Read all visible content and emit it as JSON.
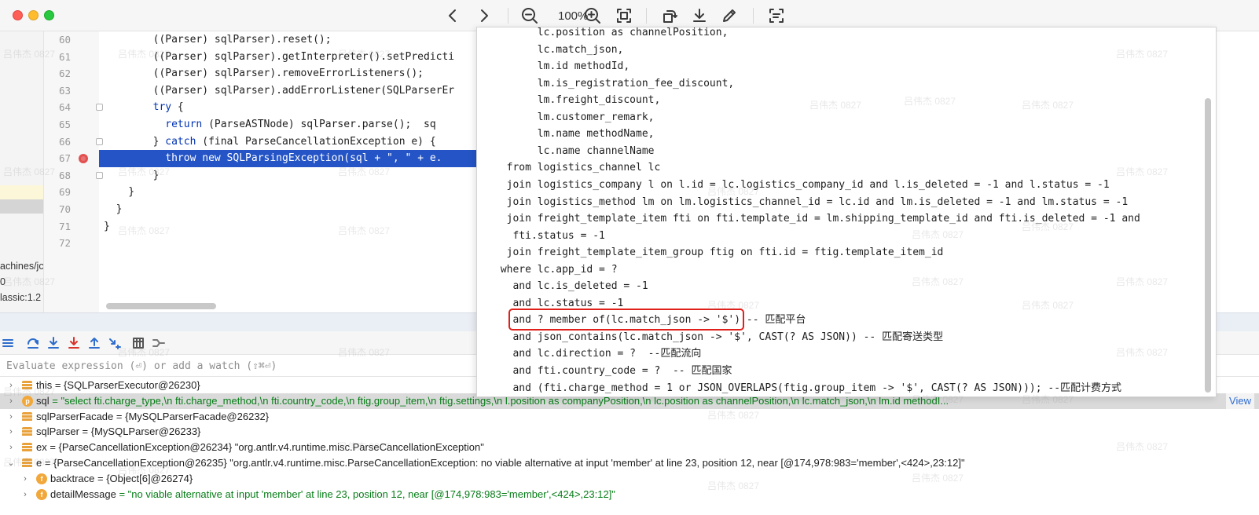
{
  "toolbar": {
    "zoom_level": "100%",
    "icons": [
      "chevron-left-icon",
      "chevron-right-icon",
      "zoom-out-icon",
      "zoom-in-icon",
      "fit-screen-icon",
      "rotate-icon",
      "download-icon",
      "edit-icon",
      "scan-text-icon"
    ]
  },
  "left_strip": {
    "lines": [
      "achines/jc",
      "0",
      "lassic:1.2"
    ]
  },
  "editor": {
    "lines": [
      {
        "no": "60",
        "text": "        ((Parser) sqlParser).reset();"
      },
      {
        "no": "61",
        "text": "        ((Parser) sqlParser).getInterpreter().setPredicti"
      },
      {
        "no": "62",
        "text": "        ((Parser) sqlParser).removeErrorListeners();"
      },
      {
        "no": "63",
        "text": "        ((Parser) sqlParser).addErrorListener(SQLParserEr"
      },
      {
        "no": "64",
        "kw": "try",
        "text": " {"
      },
      {
        "no": "65",
        "kw": "return",
        "text": " (ParseASTNode) sqlParser.parse();  sq"
      },
      {
        "no": "66",
        "pre": "} ",
        "kw": "catch",
        "text": " (final ParseCancellationException e) {"
      },
      {
        "no": "67",
        "kw": "throw new",
        "text": " SQLParsingException(sql + \", \" + e."
      },
      {
        "no": "68",
        "text": "        }"
      },
      {
        "no": "69",
        "text": "    }"
      },
      {
        "no": "70",
        "text": "  }"
      },
      {
        "no": "71",
        "text": "}"
      },
      {
        "no": "72",
        "text": ""
      }
    ]
  },
  "sql_preview": {
    "lines": [
      "       lc.position as channelPosition,",
      "       lc.match_json,",
      "       lm.id methodId,",
      "       lm.is_registration_fee_discount,",
      "       lm.freight_discount,",
      "       lm.customer_remark,",
      "       lm.name methodName,",
      "       lc.name channelName",
      "  from logistics_channel lc",
      "  join logistics_company l on l.id = lc.logistics_company_id and l.is_deleted = -1 and l.status = -1",
      "  join logistics_method lm on lm.logistics_channel_id = lc.id and lm.is_deleted = -1 and lm.status = -1",
      "  join freight_template_item fti on fti.template_id = lm.shipping_template_id and fti.is_deleted = -1 and",
      "   fti.status = -1",
      "  join freight_template_item_group ftig on fti.id = ftig.template_item_id",
      " where lc.app_id = ?",
      "   and lc.is_deleted = -1",
      "   and lc.status = -1",
      "   and ? member of(lc.match_json -> '$') -- 匹配平台",
      "   and json_contains(lc.match_json -> '$', CAST(? AS JSON)) -- 匹配寄送类型",
      "   and lc.direction = ?  --匹配流向",
      "   and fti.country_code = ?  -- 匹配国家",
      "   and (fti.charge_method = 1 or JSON_OVERLAPS(ftig.group_item -> '$', CAST(? AS JSON))); --匹配计费方式"
    ]
  },
  "debugger": {
    "eval_placeholder": "Evaluate expression (⏎) or add a watch (⇧⌘⏎)",
    "variables": [
      {
        "name": "this",
        "value": " = {SQLParserExecutor@26230}",
        "icon": "stack",
        "caret": "›",
        "indent": 0
      },
      {
        "name": "sql",
        "value": " = \"select fti.charge_type,\\n            fti.charge_method,\\n            fti.country_code,\\n            ftig.group_item,\\n            ftig.settings,\\n            l.position as companyPosition,\\n            lc.position as channelPosition,\\n            lc.match_json,\\n            lm.id methodI...",
        "icon": "p",
        "caret": "›",
        "indent": 0,
        "selected": true,
        "link": "View"
      },
      {
        "name": "sqlParserFacade",
        "value": " = {MySQLParserFacade@26232}",
        "icon": "stack",
        "caret": "›",
        "indent": 0
      },
      {
        "name": "sqlParser",
        "value": " = {MySQLParser@26233}",
        "icon": "stack",
        "caret": "›",
        "indent": 0
      },
      {
        "name": "ex",
        "value": " = {ParseCancellationException@26234} \"org.antlr.v4.runtime.misc.ParseCancellationException\"",
        "icon": "stack",
        "caret": "›",
        "indent": 0
      },
      {
        "name": "e",
        "value": " = {ParseCancellationException@26235} \"org.antlr.v4.runtime.misc.ParseCancellationException: no viable alternative at input 'member' at line 23, position 12, near [@174,978:983='member',<424>,23:12]\"",
        "icon": "stack",
        "caret": "⌄",
        "indent": 0
      },
      {
        "name": "backtrace",
        "value": " = {Object[6]@26274}",
        "icon": "f",
        "caret": "›",
        "indent": 1
      },
      {
        "name": "detailMessage",
        "value": " = \"no viable alternative at input 'member' at line 23, position 12, near [@174,978:983='member',<424>,23:12]\"",
        "icon": "f",
        "caret": "›",
        "indent": 1,
        "str": true
      }
    ]
  },
  "watermark_text": "吕伟杰 0827",
  "colors": {
    "highlight_row": "#2454c5",
    "annotation_box": "#e0201b",
    "keyword": "#0033b3",
    "string_value": "#067d17"
  }
}
